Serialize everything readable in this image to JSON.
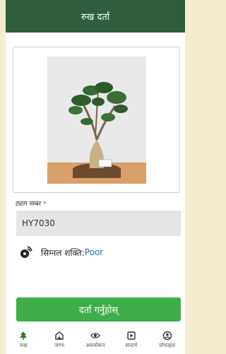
{
  "header": {
    "title": "रुख दर्ता"
  },
  "form": {
    "tag_label": "ट्याग नम्बर",
    "required_mark": "*",
    "tag_value": "HY7030",
    "signal_label": "सिग्नल शक्ति:",
    "signal_value": "Poor",
    "submit_label": "दर्ता गर्नुहोस्"
  },
  "nav": {
    "items": [
      {
        "label": "रुख",
        "icon": "tree-icon",
        "active": true
      },
      {
        "label": "जग्गा",
        "icon": "land-icon",
        "active": false
      },
      {
        "label": "अवलोकन",
        "icon": "eye-icon",
        "active": false
      },
      {
        "label": "सन्दर्भ",
        "icon": "reference-icon",
        "active": false
      },
      {
        "label": "प्रोफाइल",
        "icon": "profile-icon",
        "active": false
      }
    ]
  },
  "colors": {
    "header_bg": "#2e5e3e",
    "primary_button": "#3fae49",
    "active_nav": "#2e7d32",
    "signal_value": "#1f6fb0"
  }
}
